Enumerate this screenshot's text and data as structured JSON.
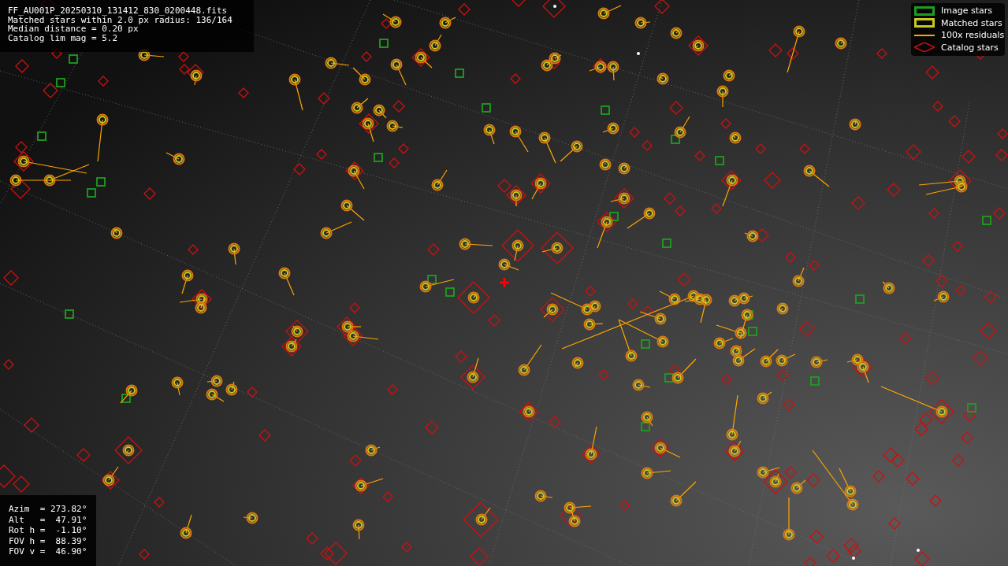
{
  "header": {
    "lines": [
      "FF_AU001P_20250310_131412_830_0200448.fits",
      "Matched stars within 2.0 px radius: 136/164",
      "Median distance = 0.20 px",
      "Catalog lim mag = 5.2"
    ]
  },
  "legend": {
    "items": [
      {
        "kind": "image",
        "label": "Image stars",
        "color": "#1e9e1e"
      },
      {
        "kind": "matched",
        "label": "Matched stars",
        "color": "#c8c81e"
      },
      {
        "kind": "residual",
        "label": "100x residuals",
        "color": "#ffa500"
      },
      {
        "kind": "catalog",
        "label": "Catalog stars",
        "color": "#cc1010"
      }
    ]
  },
  "pointing": {
    "lines": [
      "Azim  = 273.82°",
      "Alt   =  47.91°",
      "Rot h =  -1.10°",
      "FOV h =  88.39°",
      "FOV v =  46.90°"
    ]
  }
}
